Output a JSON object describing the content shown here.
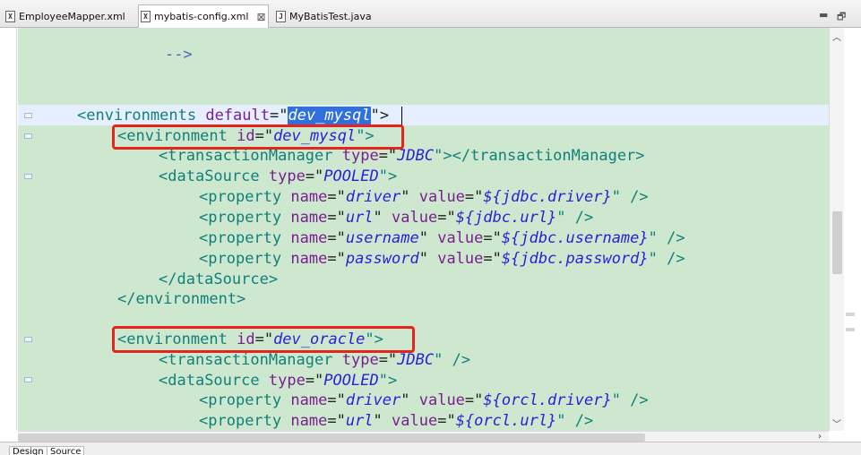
{
  "tabs": [
    {
      "icon": "X",
      "label": "EmployeeMapper.xml",
      "active": false
    },
    {
      "icon": "X",
      "label": "mybatis-config.xml",
      "active": true,
      "close": "⊠"
    },
    {
      "icon": "J",
      "label": "MyBatisTest.java",
      "active": false
    }
  ],
  "window_controls": {
    "minimize": "▬",
    "maximize": "🗗"
  },
  "code": {
    "comment_end": "-->",
    "environments": {
      "open": "<",
      "tag": "environments",
      "attr": "default",
      "eq": "=\"",
      "value": "dev_mysql",
      "close": "\">"
    },
    "env_mysql": {
      "open": "<",
      "tag": "environment",
      "attr": "id",
      "eq": "=\"",
      "value": "dev_mysql",
      "close": "\">"
    },
    "tx1": {
      "open": "<",
      "tag": "transactionManager",
      "attr": "type",
      "eq": "=\"",
      "value": "JDBC",
      "close": "\"></transactionManager>"
    },
    "ds1": {
      "open": "<",
      "tag": "dataSource",
      "attr": "type",
      "eq": "=\"",
      "value": "POOLED",
      "close": "\">"
    },
    "p1": {
      "open": "<",
      "tag": "property",
      "n": "name",
      "q1": "=\"",
      "nv": "driver",
      "q2": "\" ",
      "v": "value",
      "q3": "=\"",
      "vv": "${jdbc.driver}",
      "close": "\" />"
    },
    "p2": {
      "open": "<",
      "tag": "property",
      "n": "name",
      "q1": "=\"",
      "nv": "url",
      "q2": "\" ",
      "v": "value",
      "q3": "=\"",
      "vv": "${jdbc.url}",
      "close": "\" />"
    },
    "p3": {
      "open": "<",
      "tag": "property",
      "n": "name",
      "q1": "=\"",
      "nv": "username",
      "q2": "\" ",
      "v": "value",
      "q3": "=\"",
      "vv": "${jdbc.username}",
      "close": "\" />"
    },
    "p4": {
      "open": "<",
      "tag": "property",
      "n": "name",
      "q1": "=\"",
      "nv": "password",
      "q2": "\" ",
      "v": "value",
      "q3": "=\"",
      "vv": "${jdbc.password}",
      "close": "\" />"
    },
    "ds1_end": "</dataSource>",
    "env1_end": "</environment>",
    "env_oracle": {
      "open": "<",
      "tag": "environment",
      "attr": "id",
      "eq": "=\"",
      "value": "dev_oracle",
      "close": "\">"
    },
    "tx2": {
      "open": "<",
      "tag": "transactionManager",
      "attr": "type",
      "eq": "=\"",
      "value": "JDBC",
      "close": "\" />"
    },
    "ds2": {
      "open": "<",
      "tag": "dataSource",
      "attr": "type",
      "eq": "=\"",
      "value": "POOLED",
      "close": "\">"
    },
    "p5": {
      "open": "<",
      "tag": "property",
      "n": "name",
      "q1": "=\"",
      "nv": "driver",
      "q2": "\" ",
      "v": "value",
      "q3": "=\"",
      "vv": "${orcl.driver}",
      "close": "\" />"
    },
    "p6": {
      "open": "<",
      "tag": "property",
      "n": "name",
      "q1": "=\"",
      "nv": "url",
      "q2": "\" ",
      "v": "value",
      "q3": "=\"",
      "vv": "${orcl.url}",
      "close": "\" />"
    }
  },
  "bottom_tabs": [
    "Design",
    "Source"
  ],
  "colors": {
    "editor_bg": "#cde8cf",
    "tag": "#11807a",
    "attr": "#7a1f8f",
    "value": "#2a1fd8",
    "highlight_box": "#e5251c"
  }
}
